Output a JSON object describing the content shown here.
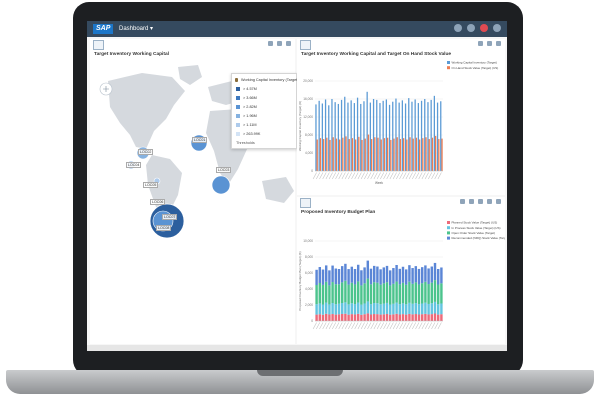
{
  "shellbar": {
    "logo": "SAP",
    "title": "Dashboard ▾"
  },
  "map_panel": {
    "title": "Target Inventory Working Capital",
    "legend": {
      "title": "Working Capital Inventory (Target)",
      "rows": [
        {
          "label": "> 4.57M",
          "color": "#2c5f9e"
        },
        {
          "label": "> 3.66M",
          "color": "#3d79bf"
        },
        {
          "label": "> 2.82M",
          "color": "#5a93d3"
        },
        {
          "label": "> 1.96M",
          "color": "#86b2e0"
        },
        {
          "label": "> 1.11M",
          "color": "#aecbec"
        },
        {
          "label": "> 263.99K",
          "color": "#d3e3f5"
        }
      ],
      "footer": "Thresholds"
    },
    "location_labels": [
      "LOC02",
      "LOC04",
      "LOC01",
      "LOC03",
      "LOC05",
      "LOC06",
      "LOC07",
      "LOC08"
    ]
  },
  "chart_data": [
    {
      "type": "bar",
      "title": "Target Inventory Working Capital and Target On Hand Stock Value",
      "xlabel": "Week",
      "ylabel": "Working Capital Inventory (Target) (K)",
      "ylim": [
        0,
        20000
      ],
      "legend_position": "top-right",
      "series": [
        {
          "name": "Working Capital Inventory (Target)",
          "color": "#5b9bd5",
          "values": [
            14800,
            15600,
            15000,
            15900,
            14600,
            16000,
            15300,
            14900,
            15800,
            16500,
            15200,
            15700,
            15100,
            16300,
            14900,
            15500,
            17600,
            15200,
            16000,
            15800,
            15100,
            15600,
            15900,
            14700,
            15400,
            16100,
            15200,
            15700,
            15000,
            16200,
            15400,
            15900,
            15100,
            15600,
            16000,
            15300,
            15800,
            16700,
            15200,
            15500
          ]
        },
        {
          "name": "On Hand Stock Value (Target) (US)",
          "color": "#ed7d52",
          "values": [
            7000,
            7300,
            7100,
            7400,
            6900,
            7500,
            7200,
            7000,
            7400,
            7700,
            7100,
            7300,
            7000,
            7600,
            6900,
            7200,
            8100,
            7100,
            7500,
            7400,
            7000,
            7300,
            7400,
            6900,
            7200,
            7500,
            7100,
            7300,
            7000,
            7500,
            7200,
            7400,
            7000,
            7300,
            7500,
            7100,
            7400,
            7800,
            7100,
            7200
          ]
        }
      ]
    },
    {
      "type": "bar",
      "title": "Proposed Inventory Budget Plan",
      "ylabel": "Proposed Inventory Budget Plan (Target) (K)",
      "ylim": [
        0,
        10000
      ],
      "legend_position": "top-right",
      "series": [
        {
          "name": "Planned Stock Value (Target) (US)",
          "color": "#ed6a7a",
          "values": [
            800,
            850,
            780,
            900,
            820,
            870,
            800,
            840,
            880,
            910,
            790,
            860,
            820,
            900,
            780,
            850,
            950,
            810,
            870,
            860,
            800,
            840,
            880,
            790,
            830,
            900,
            810,
            860,
            800,
            880,
            830,
            870,
            810,
            850,
            890,
            820,
            860,
            940,
            800,
            850
          ]
        },
        {
          "name": "In Process Stock Value (Target) (US)",
          "color": "#63c5e0",
          "values": [
            1300,
            1350,
            1280,
            1400,
            1250,
            1380,
            1300,
            1320,
            1370,
            1420,
            1290,
            1360,
            1300,
            1400,
            1270,
            1340,
            1500,
            1300,
            1380,
            1360,
            1290,
            1330,
            1380,
            1270,
            1320,
            1400,
            1300,
            1350,
            1290,
            1390,
            1320,
            1370,
            1300,
            1340,
            1400,
            1310,
            1360,
            1450,
            1290,
            1340
          ]
        },
        {
          "name": "Open Order Stock Value (Target)",
          "color": "#4cc48d",
          "values": [
            2400,
            2550,
            2450,
            2600,
            2380,
            2620,
            2500,
            2430,
            2580,
            2700,
            2470,
            2560,
            2450,
            2650,
            2400,
            2520,
            2850,
            2480,
            2600,
            2570,
            2450,
            2540,
            2590,
            2390,
            2500,
            2630,
            2470,
            2560,
            2440,
            2640,
            2500,
            2590,
            2460,
            2540,
            2610,
            2490,
            2570,
            2720,
            2470,
            2520
          ]
        },
        {
          "name": "Recommended (NRQ) Stock Value (Target)",
          "color": "#5b86d6",
          "values": [
            1900,
            2000,
            1920,
            2050,
            1880,
            2060,
            1960,
            1910,
            2030,
            2120,
            1940,
            2010,
            1930,
            2080,
            1890,
            1990,
            2250,
            1950,
            2040,
            2020,
            1920,
            1990,
            2040,
            1880,
            1970,
            2070,
            1940,
            2010,
            1920,
            2070,
            1970,
            2030,
            1940,
            2000,
            2050,
            1950,
            2020,
            2150,
            1940,
            1980
          ]
        }
      ]
    }
  ]
}
